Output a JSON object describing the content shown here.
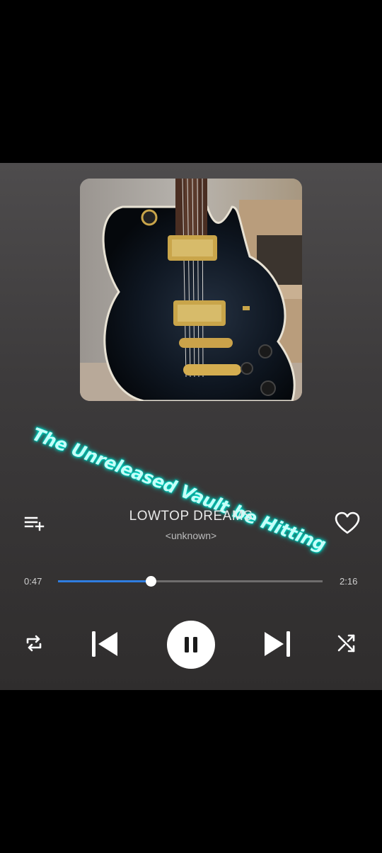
{
  "now_playing": {
    "title": "LOWTOP DREAMS",
    "artist": "<unknown>"
  },
  "overlay_caption": "The Unreleased Vault be Hitting",
  "progress": {
    "elapsed": "0:47",
    "total": "2:16",
    "fraction": 0.35
  },
  "icons": {
    "queue": "add-to-queue-icon",
    "favorite": "heart-outline-icon",
    "repeat": "repeat-icon",
    "previous": "skip-previous-icon",
    "play_pause": "pause-icon",
    "next": "skip-next-icon",
    "shuffle": "shuffle-icon"
  },
  "colors": {
    "accent": "#2f7de0",
    "caption": "#c6fff9",
    "caption_glow": "#00e5d2"
  }
}
